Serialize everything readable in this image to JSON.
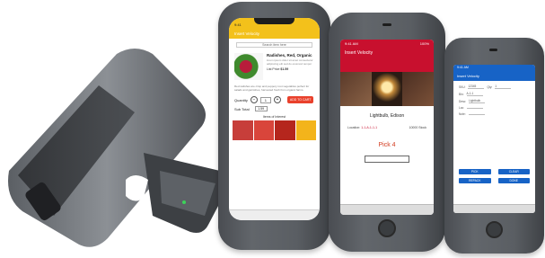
{
  "phone1": {
    "title": "Insert Velocity",
    "status_time": "9:41",
    "search_placeholder": "Search item here",
    "product_name": "Radishes, Red, Organic",
    "product_desc": "lorem ipsum dolor sit amet consectetur adipiscing elit sed do eiusmod tempor",
    "price_label": "List Price",
    "price_value": "$1.59",
    "paragraph": "Red radishes are crisp and peppery root vegetables perfect for salads and garnishes, harvested fresh from organic farms.",
    "quantity_label": "Quantity",
    "minus": "−",
    "plus": "+",
    "quantity_value": "1",
    "add_to_cart": "ADD TO CART",
    "subtotal_label": "Sub Total",
    "subtotal_value": "1.59",
    "also_label": "Items of Interest",
    "thumb_colors": [
      "#c73e3a",
      "#d9453b",
      "#b5261d",
      "#f3b41b"
    ]
  },
  "phone2": {
    "status_time": "9:41 AM",
    "status_battery": "100%",
    "title": "Insert Velocity",
    "product_name": "Lightbulb, Edison",
    "location_label": "Location:",
    "location_value": "1-1-A-1-1-1",
    "stock_label": "10000 Stock",
    "pick_label": "Pick 4"
  },
  "phone3": {
    "status_time": "9:41 AM",
    "title": "Insert Velocity",
    "rows": [
      {
        "k": "SKU:",
        "v": "12345",
        "k2": "Qty:",
        "v2": "1"
      },
      {
        "k": "Bin:",
        "v": "A-1-1",
        "k2": "",
        "v2": ""
      },
      {
        "k": "Desc:",
        "v": "Lightbulb",
        "k2": "",
        "v2": ""
      },
      {
        "k": "Loc:",
        "v": "",
        "k2": "",
        "v2": ""
      },
      {
        "k": "Note:",
        "v": "",
        "k2": "",
        "v2": ""
      }
    ],
    "buttons": [
      "PICK",
      "CLEAR",
      "REPACK",
      "DONE"
    ]
  }
}
